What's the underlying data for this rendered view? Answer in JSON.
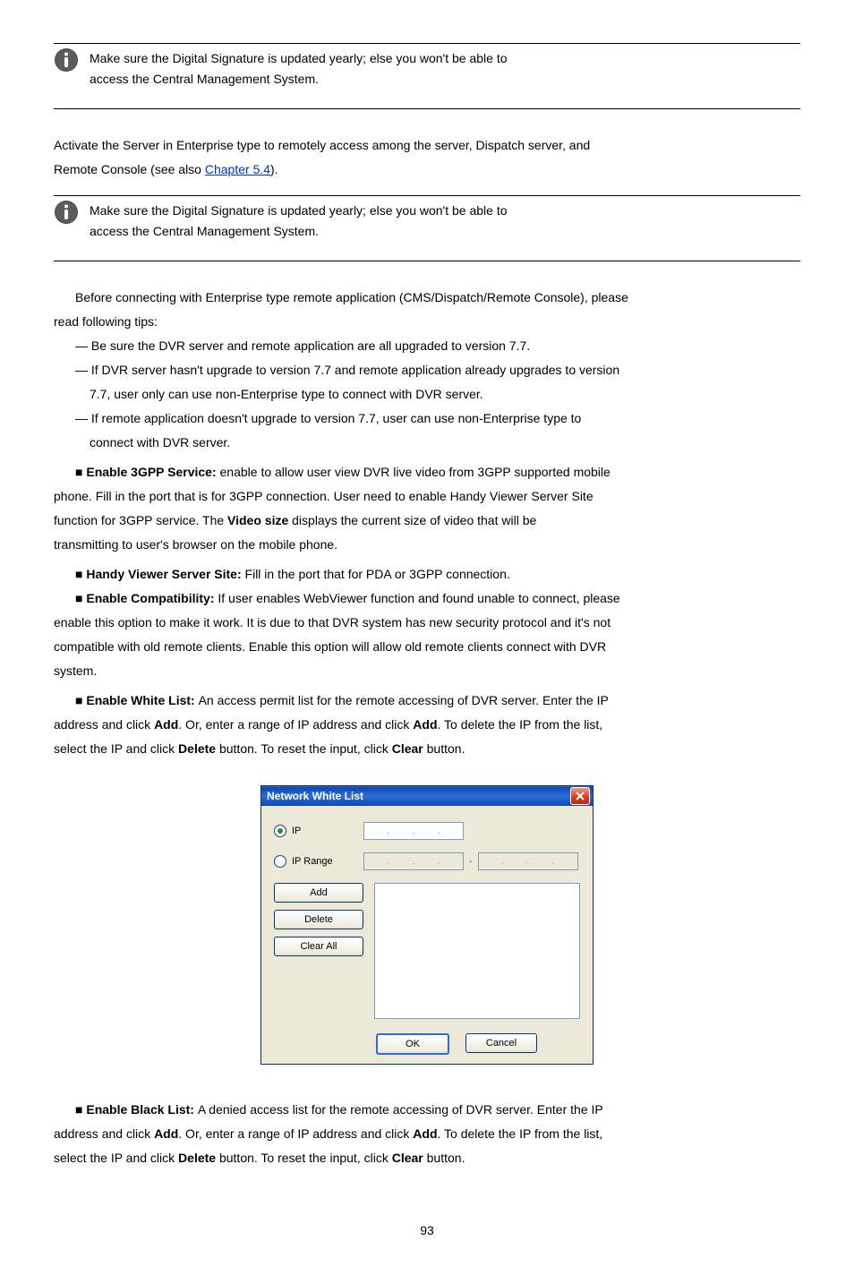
{
  "page_number": "93",
  "info1": {
    "line1_prefix": "Make sure the Digital Signature is up",
    "line1_suffix": "dated yearly; else you won't be able to",
    "line2": "access the Central Management System."
  },
  "midtext": {
    "p1": "Activate the Server in Enterprise type to remotely access among the server, Dispatch server, and",
    "p2_prefix": "Remote Console (see also ",
    "p2_link": "Chapter 5.4",
    "p2_suffix": ")."
  },
  "info2": {
    "line1": "Make sure the Digital Signature is updated yearly; else you won't be able to",
    "line2": "access the Central Management System."
  },
  "para_a": {
    "text": "Before connecting with Enterprise type remote application (CMS/Dispatch/Remote Console), please",
    "cont": "read following tips:"
  },
  "bullets": {
    "a1": "Be sure the DVR server and remote application are all upgraded to version 7.7.",
    "a2": "If DVR server hasn't upgrade to version 7.7 and remote application already upgrades to version",
    "a2_cont": "7.7, user only can use non-Enterprise type to connect with DVR server.",
    "a3": "If remote application doesn't upgrade to version 7.7, user can use non-Enterprise type to",
    "a3_cont": "connect with DVR server."
  },
  "para_b": {
    "b1_title": "Enable 3GPP Service: ",
    "b1_text": "enable to allow user view DVR live video from 3GPP supported mobile",
    "b1_cont1": "phone. Fill in the port that is for 3GPP connection. User need to enable Handy Viewer Server Site",
    "b1_cont2": "function for 3GPP service. The ",
    "b1_bold": "Video size",
    "b1_cont2b": " displays the current size of video that will be",
    "b1_cont3": "transmitting to user's browser on the mobile phone."
  },
  "para_c": {
    "c1_title": "Handy Viewer Server Site: ",
    "c1_text": "Fill in the port that for PDA or 3GPP connection.",
    "c2_title": "Enable Compatibility: ",
    "c2_text": "If user enables WebViewer function and found unable to connect, please",
    "c2_cont1": "enable this option to make it work. It is due to that DVR system has new security protocol and it's not",
    "c2_cont2": "compatible with old remote clients. Enable this option will allow old remote clients connect with DVR",
    "c2_cont3": "system."
  },
  "para_d": {
    "d1_title": "Enable White List: ",
    "d1_text": "An access permit list for the remote accessing of DVR server. Enter the IP",
    "d1_cont": "address and click ",
    "d1_bold": "Add",
    "d1_cont2": ". Or, enter a range of IP address and click ",
    "d1_bold2": "Add",
    "d1_cont3": ". To delete the IP from the list,",
    "d1_cont4": "select the IP and click ",
    "d1_bold3": "Delete",
    "d1_cont5": " button. To reset the input, click ",
    "d1_bold4": "Clear",
    "d1_cont6": " button."
  },
  "dialog": {
    "title": "Network White List",
    "radio_ip": "IP",
    "radio_range": "IP Range",
    "btn_add": "Add",
    "btn_delete": "Delete",
    "btn_clear": "Clear All",
    "btn_ok": "OK",
    "btn_cancel": "Cancel",
    "dot": ".",
    "dash": "-"
  },
  "para_e": {
    "e1_title": "Enable Black List: ",
    "e1_text": "A denied access list for the remote accessing of DVR server. Enter the IP",
    "e1_cont1": "address and click ",
    "e1_bold1": "Add",
    "e1_cont2": ". Or, enter a range of IP address and click ",
    "e1_bold2": "Add",
    "e1_cont3": ". To delete the IP from the list,",
    "e1_cont4": "select the IP and click ",
    "e1_bold3": "Delete",
    "e1_cont5": " button. To reset the input, click ",
    "e1_bold4": "Clear",
    "e1_cont6": " button."
  }
}
